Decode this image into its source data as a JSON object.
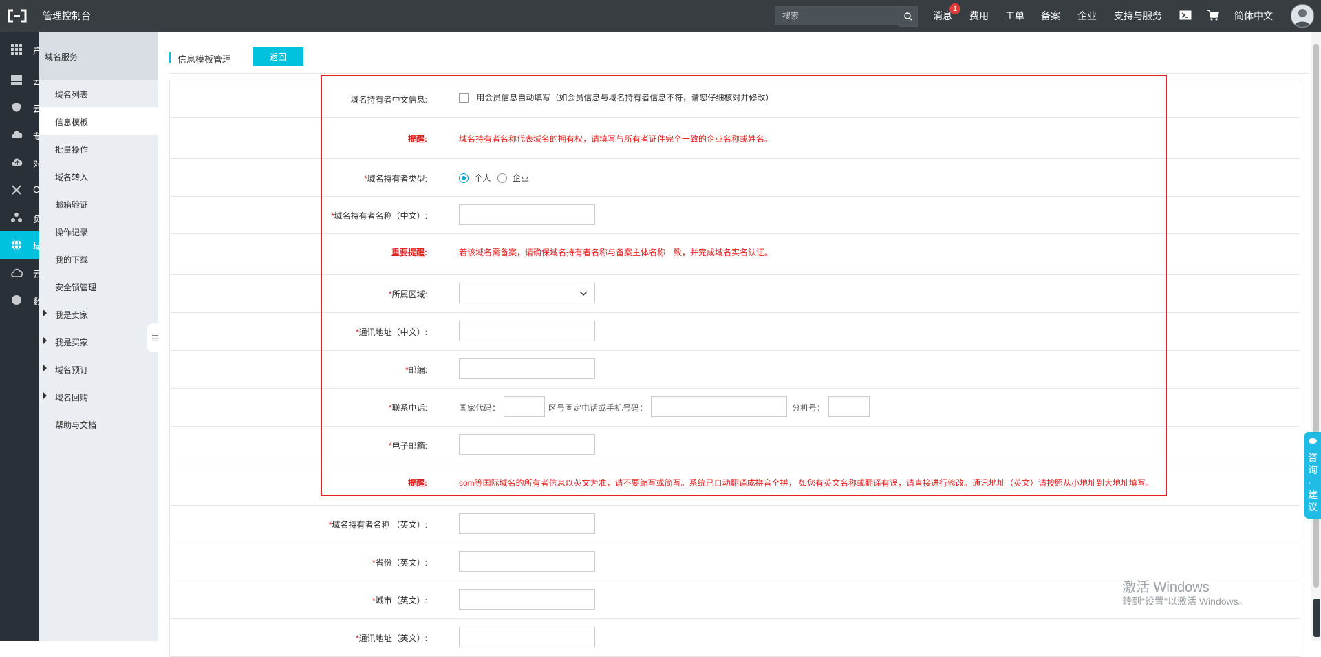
{
  "topbar": {
    "console_title": "管理控制台",
    "search_placeholder": "搜索",
    "nav": [
      "消息",
      "费用",
      "工单",
      "备案",
      "企业",
      "支持与服务",
      "简体中文"
    ],
    "message_badge": "1"
  },
  "rail": {
    "labels": [
      "产",
      "云",
      "云",
      "专",
      "对",
      "C",
      "负",
      "域",
      "云",
      "数"
    ]
  },
  "subnav": {
    "title": "域名服务",
    "items": [
      {
        "label": "域名列表"
      },
      {
        "label": "信息模板"
      },
      {
        "label": "批量操作"
      },
      {
        "label": "域名转入"
      },
      {
        "label": "邮箱验证"
      },
      {
        "label": "操作记录"
      },
      {
        "label": "我的下载"
      },
      {
        "label": "安全锁管理"
      },
      {
        "label": "我是卖家"
      },
      {
        "label": "我是买家"
      },
      {
        "label": "域名预订"
      },
      {
        "label": "域名回购"
      },
      {
        "label": "帮助与文档"
      }
    ],
    "collapse_glyph": "☰"
  },
  "page": {
    "title": "信息模板管理",
    "back_label": "返回"
  },
  "form": {
    "row_cn_info": {
      "label": "域名持有者中文信息:",
      "checkbox_text": "用会员信息自动填写（如会员信息与域名持有者信息不符，请您仔细核对并修改）"
    },
    "row_tip1": {
      "label": "提醒:",
      "text": "域名持有者名称代表域名的拥有权，请填写与所有者证件完全一致的企业名称或姓名。"
    },
    "row_type": {
      "label": "域名持有者类型:",
      "option1": "个人",
      "option2": "企业"
    },
    "row_name_cn": {
      "label": "域名持有者名称（中文）:"
    },
    "row_tip2": {
      "label": "重要提醒:",
      "text": "若该域名需备案，请确保域名持有者名称与备案主体名称一致，并完成域名实名认证。"
    },
    "row_region": {
      "label": "所属区域:"
    },
    "row_addr_cn": {
      "label": "通讯地址（中文）:"
    },
    "row_zip": {
      "label": "邮编:"
    },
    "row_phone": {
      "label": "联系电话:",
      "country_code": "国家代码：",
      "local_number": "区号固定电话或手机号码：",
      "extension": "分机号："
    },
    "row_email": {
      "label": "电子邮箱:"
    },
    "row_tip3": {
      "label": "提醒:",
      "text": "com等国际域名的所有者信息以英文为准，请不要缩写或简写。系统已自动翻译成拼音全拼， 如您有英文名称或翻译有误，请直接进行修改。通讯地址（英文）请按照从小地址到大地址填写。"
    },
    "row_name_en": {
      "label": "域名持有者名称 （英文）:"
    },
    "row_province_en": {
      "label": "省份（英文）:"
    },
    "row_city_en": {
      "label": "城市（英文）:"
    },
    "row_addr_en": {
      "label": "通讯地址（英文）:"
    }
  },
  "float": {
    "consult": "咨询·建议"
  },
  "watermark": {
    "line1": "激活 Windows",
    "line2": "转到\"设置\"以激活 Windows。"
  }
}
